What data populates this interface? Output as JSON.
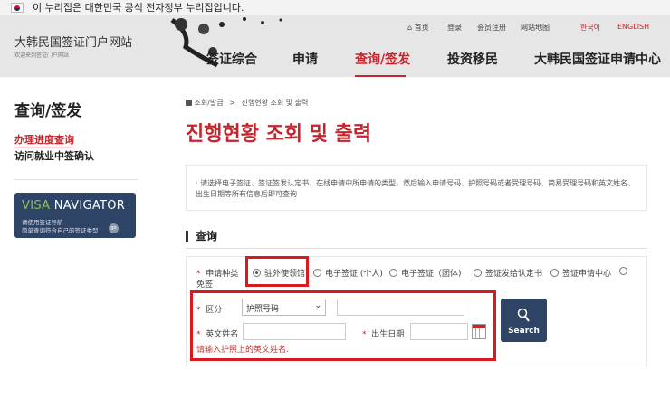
{
  "gov_banner": {
    "text": "이 누리집은 대한민국 공식 전자정부 누리집입니다."
  },
  "header": {
    "site_title": "大韩民国签证门户网站",
    "site_subtitle": "欢迎来到签证门户网站",
    "top_links": [
      "首页",
      "登录",
      "会员注册",
      "网站地图",
      "한국어",
      "ENGLISH"
    ],
    "nav": [
      "签证综合",
      "申请",
      "查询/签发",
      "投资移民",
      "大韩民国签证申请中心"
    ]
  },
  "sidebar": {
    "title": "查询/签发",
    "items": [
      "办理进度查询",
      "访问就业中签确认"
    ],
    "banner": {
      "title_a": "VISA",
      "title_b": " NAVIGATOR",
      "line1": "请使用签证导航",
      "line2": "简单查询符合自己的签证类型",
      "go": "go"
    }
  },
  "main": {
    "breadcrumb": [
      "조회/발급",
      "진행현황 조회 및 출력"
    ],
    "breadcrumb_sep": ">",
    "title": "진행현황 조회 및 출력",
    "info": "· 请选择电子签证、签证签发认定书、在线申请中所申请的类型，然后输入申请号码、护照号码或者受理号码、简易受理号码和英文姓名、出生日期等所有信息后即可查询",
    "section_title": "查询",
    "form": {
      "type_label": "申请种类",
      "types": [
        "驻外使领馆",
        "电子签证 (个人)",
        "电子签证（团体)",
        "签证发给认定书",
        "签证申请中心",
        "免签"
      ],
      "selected_type": "驻外使领馆",
      "category_label": "区分",
      "category_value": "护照号码",
      "number_value": "",
      "name_label": "英文姓名",
      "name_value": "",
      "birth_label": "出生日期",
      "birth_value": "",
      "error": "请输入护照上的英文姓名.",
      "search": "Search",
      "star": "*"
    }
  },
  "colors": {
    "accent": "#c4262e",
    "navy": "#2e4464",
    "highlight": "#d71920"
  }
}
